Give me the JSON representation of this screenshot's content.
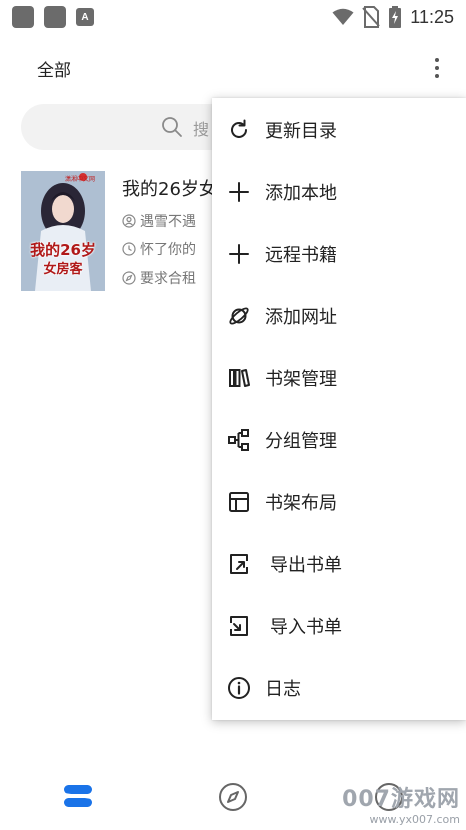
{
  "status_bar": {
    "time": "11:25",
    "left_icons": [
      "app-icon",
      "app-icon",
      "a-badge-icon"
    ],
    "a_badge": "A",
    "right_icons": [
      "wifi-icon",
      "no-sim-icon",
      "battery-charging-icon"
    ]
  },
  "app_bar": {
    "tab_label": "全部",
    "more_icon": "more-vertical-icon"
  },
  "search": {
    "placeholder": "搜"
  },
  "book": {
    "title": "我的26岁女",
    "author": "遇雪不遇",
    "latest": "怀了你的",
    "intro": "要求合租",
    "cover_title_line1": "我的26岁",
    "cover_title_line2": "女房客",
    "cover_badge": "潇湘中文网"
  },
  "menu": {
    "items": [
      {
        "label": "更新目录",
        "icon": "refresh-icon"
      },
      {
        "label": "添加本地",
        "icon": "plus-icon"
      },
      {
        "label": "远程书籍",
        "icon": "plus-icon"
      },
      {
        "label": "添加网址",
        "icon": "planet-icon"
      },
      {
        "label": "书架管理",
        "icon": "bookshelf-icon"
      },
      {
        "label": "分组管理",
        "icon": "group-icon"
      },
      {
        "label": "书架布局",
        "icon": "layout-icon"
      },
      {
        "label": "导出书单",
        "icon": "export-icon"
      },
      {
        "label": "导入书单",
        "icon": "import-icon"
      },
      {
        "label": "日志",
        "icon": "info-icon"
      }
    ]
  },
  "bottom_nav": {
    "items": [
      {
        "icon": "bookshelf-nav-icon",
        "active": true
      },
      {
        "icon": "compass-icon",
        "active": false
      },
      {
        "icon": "circle-icon",
        "active": false
      }
    ]
  },
  "watermark": {
    "main": "007游戏网",
    "url": "www.yx007.com"
  },
  "colors": {
    "accent": "#1a73e8",
    "text": "#222222",
    "muted": "#777777",
    "search_bg": "#f2f2f2"
  }
}
